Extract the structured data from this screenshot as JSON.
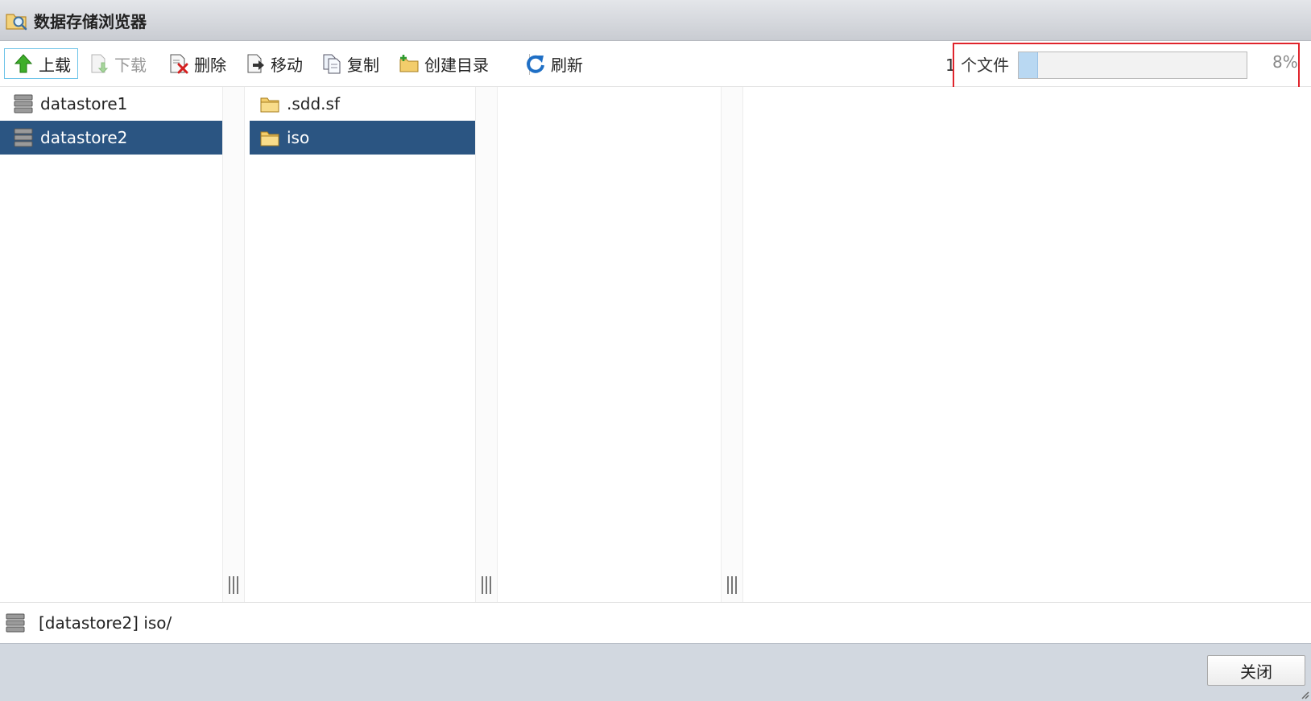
{
  "window": {
    "title": "数据存储浏览器",
    "icon": "folder-search-icon"
  },
  "toolbar": {
    "upload": "上载",
    "download": "下载",
    "delete": "删除",
    "move": "移动",
    "copy": "复制",
    "mkdir": "创建目录",
    "refresh": "刷新"
  },
  "upload_status": {
    "count_label": "1 个文件",
    "percent_label": "8%",
    "progress": 0.08
  },
  "datastores": [
    {
      "name": "datastore1",
      "selected": false
    },
    {
      "name": "datastore2",
      "selected": true
    }
  ],
  "folders": [
    {
      "name": ".sdd.sf",
      "selected": false
    },
    {
      "name": "iso",
      "selected": true
    }
  ],
  "path": {
    "text": "[datastore2] iso/"
  },
  "footer": {
    "close": "关闭"
  },
  "colors": {
    "selected_bg": "#2b5582",
    "highlight_box": "#e0242c",
    "progress_fill": "#b9d8f2"
  }
}
